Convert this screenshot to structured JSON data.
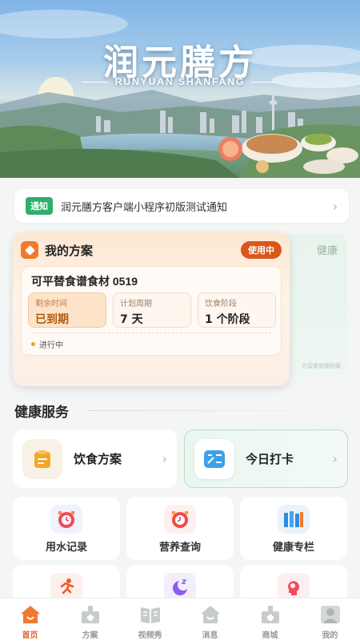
{
  "banner": {
    "title": "润元膳方",
    "subtitle": "RUNYUAN SHANFANG"
  },
  "notice": {
    "tag": "通知",
    "text": "润元膳方客户端小程序初版测试通知",
    "chevron": "›"
  },
  "side_card": {
    "label": "健康",
    "hint": "开营看健康档案"
  },
  "plan_card": {
    "title": "我的方案",
    "badge": "使用中",
    "plan_name": "可平替食谱食材 0519",
    "stats": [
      {
        "label": "剩余时间",
        "value": "已到期"
      },
      {
        "label": "计划周期",
        "value": "7 天"
      },
      {
        "label": "饮食阶段",
        "value": "1 个阶段"
      }
    ],
    "status": "进行中"
  },
  "services": {
    "title": "健康服务",
    "big": [
      {
        "label": "饮食方案",
        "chevron": "›",
        "icon": "clipboard-icon"
      },
      {
        "label": "今日打卡",
        "chevron": "›",
        "icon": "calculator-icon"
      }
    ],
    "tiles": [
      {
        "label": "用水记录",
        "icon": "water-clock-icon"
      },
      {
        "label": "营养查询",
        "icon": "alarm-clock-icon"
      },
      {
        "label": "健康专栏",
        "icon": "books-icon"
      }
    ]
  },
  "tabbar": [
    {
      "label": "首页",
      "icon": "home-icon",
      "active": true
    },
    {
      "label": "方案",
      "icon": "plan-icon"
    },
    {
      "label": "视频秀",
      "icon": "book-icon"
    },
    {
      "label": "消息",
      "icon": "message-icon"
    },
    {
      "label": "商城",
      "icon": "mall-icon"
    },
    {
      "label": "我的",
      "icon": "profile-icon"
    }
  ],
  "colors": {
    "accent": "#e0672a",
    "green": "#2fae6a",
    "badge": "#d9571a"
  }
}
